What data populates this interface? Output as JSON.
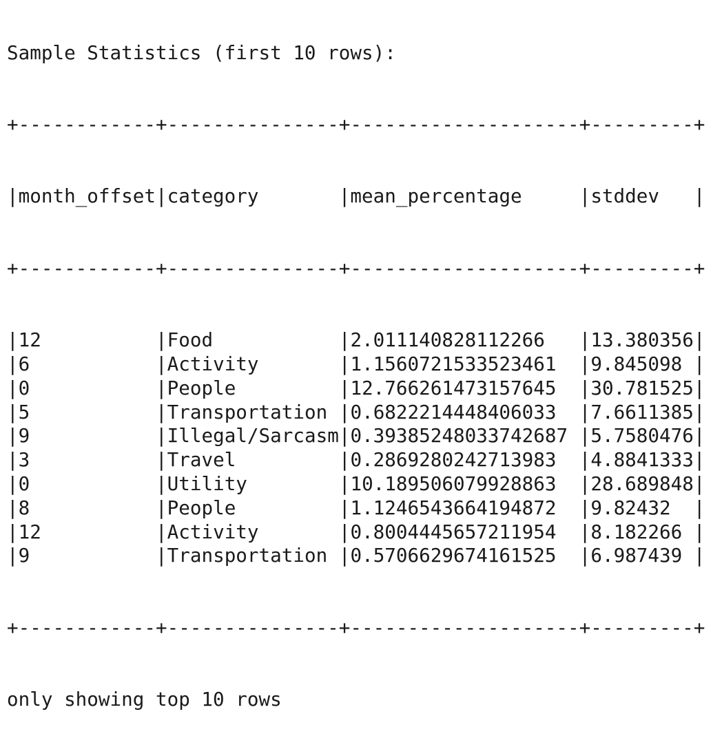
{
  "output": {
    "cut_line": "Sample Statistics (first 10 rows):",
    "heading": "Sample Statistics (first 10 rows):",
    "border": "+------------+---------------+--------------------+---------+",
    "columns": [
      "month_offset",
      "category",
      "mean_percentage",
      "stddev"
    ],
    "rows": [
      [
        "12",
        "Food",
        "2.011140828112266",
        "13.380356"
      ],
      [
        "6",
        "Activity",
        "1.1560721533523461",
        "9.845098"
      ],
      [
        "0",
        "People",
        "12.766261473157645",
        "30.781525"
      ],
      [
        "5",
        "Transportation",
        "0.6822214448406033",
        "7.6611385"
      ],
      [
        "9",
        "Illegal/Sarcasm",
        "0.39385248033742687",
        "5.7580476"
      ],
      [
        "3",
        "Travel",
        "0.2869280242713983",
        "4.8841333"
      ],
      [
        "0",
        "Utility",
        "10.189506079928863",
        "28.689848"
      ],
      [
        "8",
        "People",
        "1.1246543664194872",
        "9.82432"
      ],
      [
        "12",
        "Activity",
        "0.8004445657211954",
        "8.182266"
      ],
      [
        "9",
        "Transportation",
        "0.5706629674161525",
        "6.987439"
      ]
    ],
    "footer": "only showing top 10 rows"
  }
}
